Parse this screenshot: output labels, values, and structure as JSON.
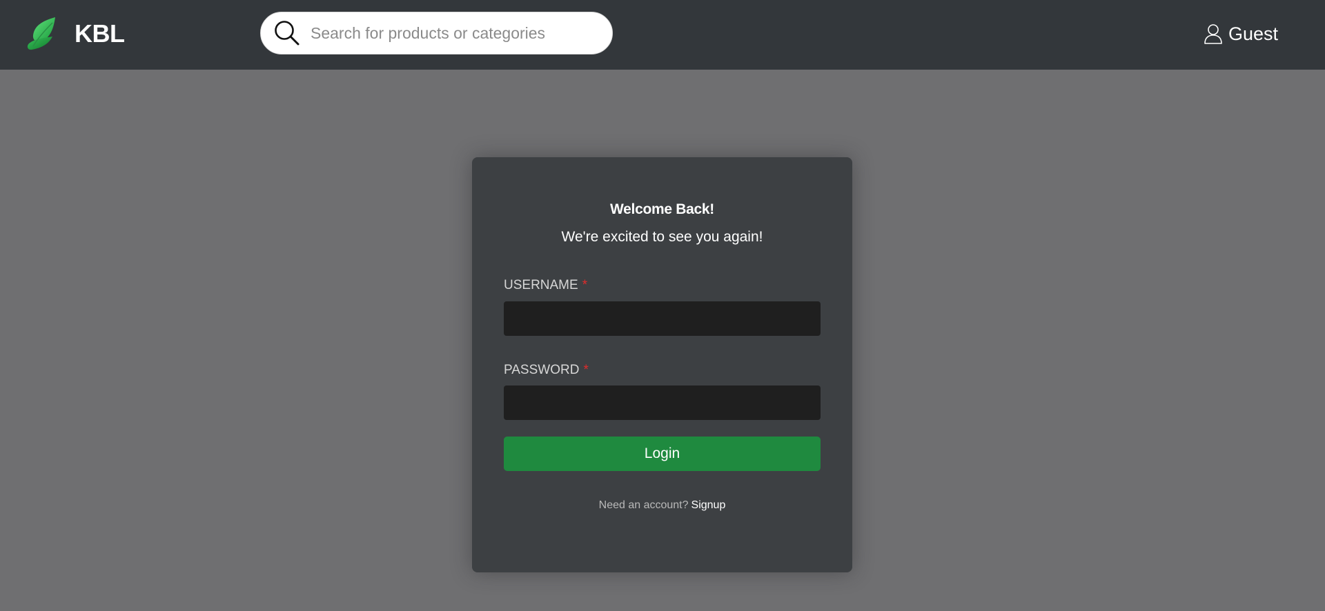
{
  "header": {
    "brand_name": "KBL",
    "logo_icon": "leaf-icon",
    "search": {
      "placeholder": "Search for products or categories",
      "value": "",
      "icon": "search-icon"
    },
    "user": {
      "icon": "user-icon",
      "label": "Guest"
    }
  },
  "login": {
    "welcome": "Welcome Back!",
    "subtitle": "We're excited to see you again!",
    "username_label": "USERNAME",
    "username_value": "",
    "password_label": "PASSWORD",
    "password_value": "",
    "required_mark": "*",
    "login_button": "Login",
    "signup_prompt": "Need an account?",
    "signup_link": "Signup"
  },
  "colors": {
    "header_bg": "#33373b",
    "page_bg": "#6f6f71",
    "card_bg": "#3d4043",
    "input_bg": "#1f1f1f",
    "accent_green": "#1f8a3f",
    "required_red": "#e02b2b"
  }
}
